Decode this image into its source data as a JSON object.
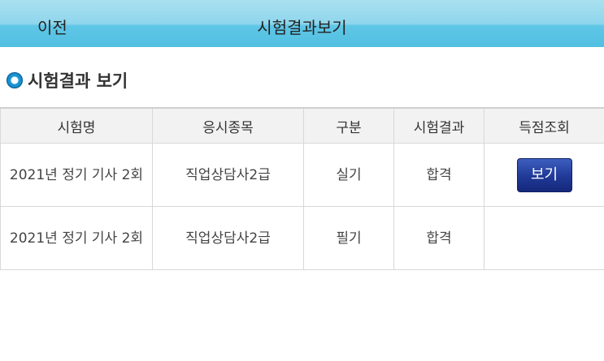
{
  "header": {
    "back_label": "이전",
    "title": "시험결과보기"
  },
  "section": {
    "title": "시험결과 보기"
  },
  "table": {
    "columns": [
      "시험명",
      "응시종목",
      "구분",
      "시험결과",
      "득점조회"
    ],
    "rows": [
      {
        "exam": "2021년 정기 기사 2회",
        "subject": "직업상담사2급",
        "type": "실기",
        "result": "합격",
        "action": "보기"
      },
      {
        "exam": "2021년 정기 기사 2회",
        "subject": "직업상담사2급",
        "type": "필기",
        "result": "합격",
        "action": ""
      }
    ]
  }
}
